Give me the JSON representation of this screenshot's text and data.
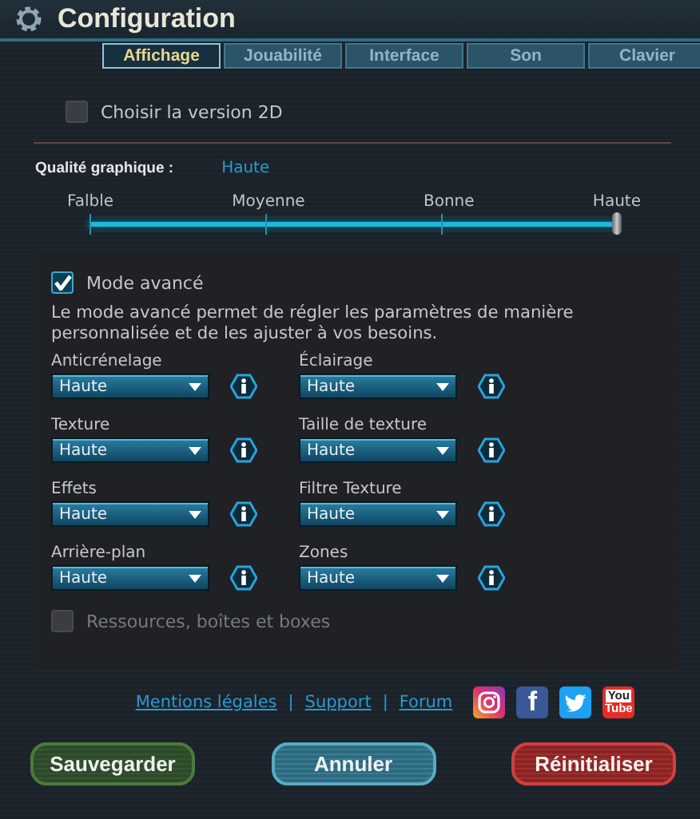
{
  "window": {
    "title": "Configuration"
  },
  "tabs": [
    {
      "label": "Affichage",
      "selected": true
    },
    {
      "label": "Jouabilité",
      "selected": false
    },
    {
      "label": "Interface",
      "selected": false
    },
    {
      "label": "Son",
      "selected": false
    },
    {
      "label": "Clavier",
      "selected": false
    }
  ],
  "version_2d": {
    "label": "Choisir la version 2D",
    "checked": false,
    "disabled": false
  },
  "quality": {
    "label": "Qualité graphique :",
    "value": "Haute",
    "steps": [
      "Falble",
      "Moyenne",
      "Bonne",
      "Haute"
    ],
    "level": 1
  },
  "advanced": {
    "checkbox": {
      "label": "Mode avancé",
      "checked": true,
      "disabled": false
    },
    "description": "Le mode avancé permet de régler les paramètres de manière personnalisée et de les ajuster à vos besoins.",
    "settings": [
      {
        "label": "Anticrénelage",
        "value": "Haute"
      },
      {
        "label": "Éclairage",
        "value": "Haute"
      },
      {
        "label": "Texture",
        "value": "Haute"
      },
      {
        "label": "Taille de texture",
        "value": "Haute"
      },
      {
        "label": "Effets",
        "value": "Haute"
      },
      {
        "label": "Filtre Texture",
        "value": "Haute"
      },
      {
        "label": "Arrière-plan",
        "value": "Haute"
      },
      {
        "label": "Zones",
        "value": "Haute"
      }
    ],
    "resources": {
      "label": "Ressources, boîtes et boxes",
      "checked": false,
      "disabled": true
    }
  },
  "links": [
    "Mentions légales",
    "Support",
    "Forum"
  ],
  "separators": [
    "|",
    "|"
  ],
  "social": [
    {
      "kind": "instagram"
    },
    {
      "kind": "facebook",
      "glyph": "f"
    },
    {
      "kind": "twitter"
    },
    {
      "kind": "youtube",
      "top": "You",
      "bottom": "Tube"
    }
  ],
  "buttons": [
    {
      "label": "Sauvegarder",
      "kind": "save"
    },
    {
      "label": "Annuler",
      "kind": "cancel"
    },
    {
      "label": "Réinitialiser",
      "kind": "reset"
    }
  ]
}
